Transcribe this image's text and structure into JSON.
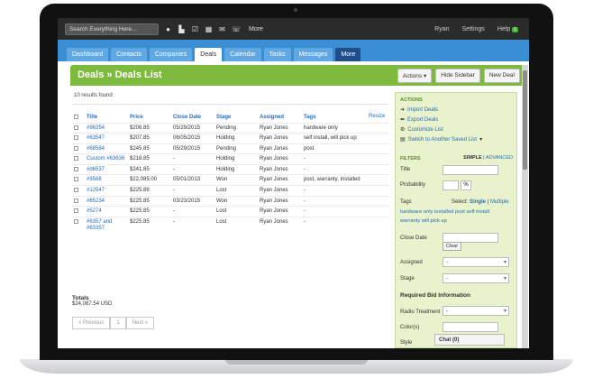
{
  "topbar": {
    "search_placeholder": "Search Everything Here...",
    "more": "More",
    "user": "Ryan",
    "settings": "Settings",
    "help": "Help",
    "help_badge": "1"
  },
  "tabs": [
    "Dashboard",
    "Contacts",
    "Companies",
    "Deals",
    "Calendar",
    "Tasks",
    "Messages",
    "More"
  ],
  "header": {
    "title": "Deals » Deals List",
    "actions_label": "Actions",
    "hide_sidebar": "Hide Sidebar",
    "new_deal": "New Deal"
  },
  "main": {
    "results": "10 results found",
    "resize": "Resize",
    "columns": [
      "Title",
      "Price",
      "Close Date",
      "Stage",
      "Assigned",
      "Tags"
    ],
    "rows": [
      [
        "#96354",
        "$206.85",
        "05/29/2015",
        "Pending",
        "Ryan Jones",
        "hardware only"
      ],
      [
        "#63547",
        "$207.85",
        "06/05/2015",
        "Holding",
        "Ryan Jones",
        "self install, will pick up"
      ],
      [
        "#68584",
        "$245.85",
        "05/29/2015",
        "Pending",
        "Ryan Jones",
        "post"
      ],
      [
        "Custom #63636",
        "$218.85",
        "-",
        "Holding",
        "Ryan Jones",
        "-"
      ],
      [
        "#d6537",
        "$241.85",
        "-",
        "Holding",
        "Ryan Jones",
        "-"
      ],
      [
        "#9568",
        "$22,085.00",
        "05/01/2013",
        "Won",
        "Ryan Jones",
        "post, warranty, installed"
      ],
      [
        "#12547",
        "$225.89",
        "-",
        "Lost",
        "Ryan Jones",
        "-"
      ],
      [
        "#65234",
        "$225.85",
        "03/23/2015",
        "Won",
        "Ryan Jones",
        "-"
      ],
      [
        "#5274",
        "$225.85",
        "-",
        "Lost",
        "Ryan Jones",
        "-"
      ],
      [
        "#6357 and #63357",
        "$225.85",
        "-",
        "Lost",
        "Ryan Jones",
        "-"
      ]
    ],
    "totals_label": "Totals",
    "totals_value": "$24,087.54 USD",
    "pager_prev": "« Previous",
    "pager_page": "1",
    "pager_next": "Next »"
  },
  "sidebar": {
    "actions_heading": "ACTIONS",
    "import": "Import Deals",
    "export": "Export Deals",
    "customize": "Customize List",
    "switch": "Switch to Another Saved List",
    "filters_heading": "FILTERS",
    "simple": "SIMPLE",
    "advanced": "ADVANCED",
    "title_label": "Title",
    "probability_label": "Probability",
    "percent": "%",
    "tags_label": "Tags",
    "select_label": "Select:",
    "select_single": "Single",
    "select_multiple": "Multiple",
    "tags_line1": "hardware only  installed  post  self install",
    "tags_line2": "warranty  will pick up",
    "close_date_label": "Close Date",
    "clear": "Clear",
    "assigned_label": "Assigned",
    "assigned_value": "-",
    "stage_label": "Stage",
    "stage_value": "-",
    "required_heading": "Required Bid Information",
    "radio_label": "Radio Treatment",
    "radio_value": "-",
    "colors_label": "Color(s)",
    "style_label": "Style"
  },
  "chat": "Chat (0)"
}
